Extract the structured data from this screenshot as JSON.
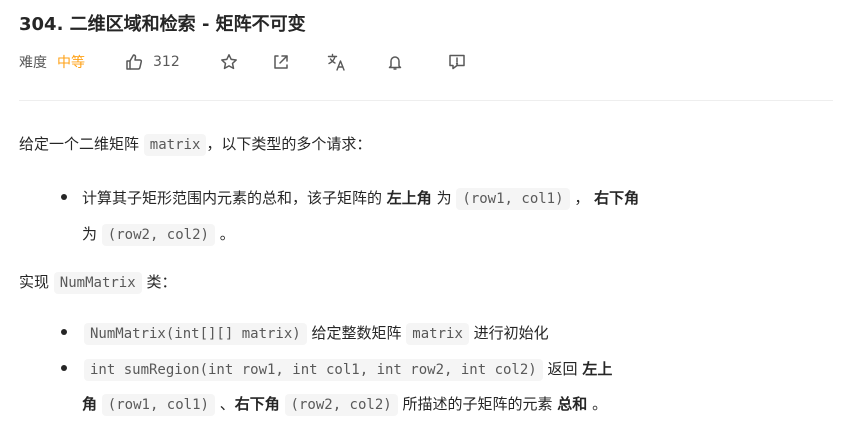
{
  "problem": {
    "title": "304. 二维区域和检索 - 矩阵不可变",
    "difficulty_label": "难度",
    "difficulty_value": "中等",
    "likes": "312"
  },
  "icons": {
    "like": "thumbs-up-icon",
    "star": "star-icon",
    "share": "share-icon",
    "translate": "translate-icon",
    "bell": "bell-icon",
    "feedback": "feedback-icon"
  },
  "description": {
    "intro_prefix": "给定一个二维矩阵",
    "intro_code": "matrix",
    "intro_suffix": "，以下类型的多个请求：",
    "bullet1": {
      "text1": "计算其子矩形范围内元素的总和，该子矩阵的",
      "bold1": "左上角",
      "text2": "为",
      "code1": "(row1, col1)",
      "text3": "，",
      "bold2": "右下角",
      "text4": "为",
      "code2": "(row2, col2)",
      "text5": "。"
    },
    "implement_prefix": "实现",
    "implement_code": "NumMatrix",
    "implement_suffix": "类：",
    "bullet2": {
      "code": "NumMatrix(int[][] matrix)",
      "text1": "给定整数矩阵",
      "code2": "matrix",
      "text2": "进行初始化"
    },
    "bullet3": {
      "code1": "int sumRegion(int row1, int col1, int row2, int col2)",
      "text1": "返回",
      "bold1": "左上",
      "bold1b": "角",
      "code2": "(row1, col1)",
      "text2": "、",
      "bold2": "右下角",
      "code3": "(row2, col2)",
      "text3": "所描述的子矩阵的元素",
      "bold3": "总和",
      "text4": "。"
    }
  }
}
